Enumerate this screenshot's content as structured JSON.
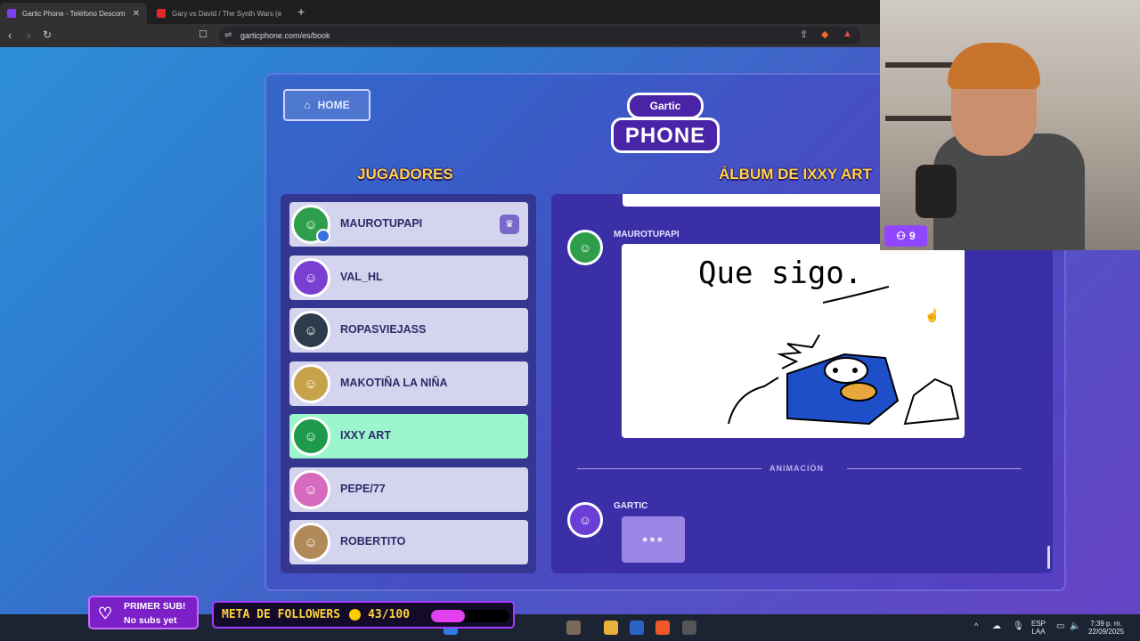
{
  "browser": {
    "tabs": [
      {
        "title": "Gartic Phone - Teléfono Descom",
        "active": true
      },
      {
        "title": "Gary vs David / The Synth Wars (e",
        "active": false
      }
    ],
    "new_tab": "+",
    "url": "garticphone.com/es/book"
  },
  "page": {
    "home_label": "HOME",
    "logo_top": "Gartic",
    "logo_bottom": "PHONE",
    "players_title": "JUGADORES",
    "album_title": "ÁLBUM DE IXXY ART",
    "players": [
      {
        "name": "MAUROTUPAPI",
        "host": true,
        "active": false,
        "color": "#2f9e4b"
      },
      {
        "name": "VAL_HL",
        "host": false,
        "active": false,
        "color": "#7a3fd0"
      },
      {
        "name": "ROPASVIEJASS",
        "host": false,
        "active": false,
        "color": "#2d3b4a"
      },
      {
        "name": "MAKOTIÑA LA NIÑA",
        "host": false,
        "active": false,
        "color": "#c8a24a"
      },
      {
        "name": "IXXY ART",
        "host": false,
        "active": true,
        "color": "#1f9a4a"
      },
      {
        "name": "PEPE/77",
        "host": false,
        "active": false,
        "color": "#d66bbd"
      },
      {
        "name": "ROBERTITO",
        "host": false,
        "active": false,
        "color": "#b28a5a"
      }
    ],
    "album": {
      "drawing_author": "MAUROTUPAPI",
      "drawing_text": "Que sigo.",
      "divider_label": "ANIMACIÓN",
      "next_author": "GARTIC",
      "typing_indicator": "•••"
    }
  },
  "stream_overlay": {
    "viewer_count": "9",
    "sub_line1": "PRIMER SUB!",
    "sub_line2": "No subs yet",
    "followers_label": "META DE FOLLOWERS",
    "followers_count": "43/100",
    "followers_progress": 0.43
  },
  "taskbar": {
    "lang_top": "ESP",
    "lang_bottom": "LAA",
    "time": "7:39 p. m.",
    "date": "22/09/2025"
  },
  "colors": {
    "accent_yellow": "#ffd64a",
    "active_player": "#9cf5cc",
    "twitch_purple": "#9147ff"
  }
}
